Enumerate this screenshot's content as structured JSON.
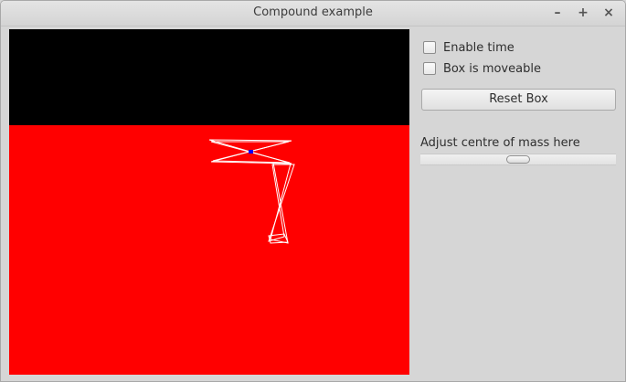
{
  "window": {
    "title": "Compound example",
    "minimize_glyph": "–",
    "maximize_glyph": "+",
    "close_glyph": "×"
  },
  "controls": {
    "enable_time": {
      "label": "Enable time",
      "checked": false
    },
    "box_moveable": {
      "label": "Box is moveable",
      "checked": false
    },
    "reset_label": "Reset Box",
    "slider": {
      "label": "Adjust centre of mass here",
      "value": 0.5
    }
  },
  "colors": {
    "sky": "#000000",
    "ground": "#ff0000",
    "outline": "#ffffff",
    "centre_marker": "#0000ff"
  }
}
